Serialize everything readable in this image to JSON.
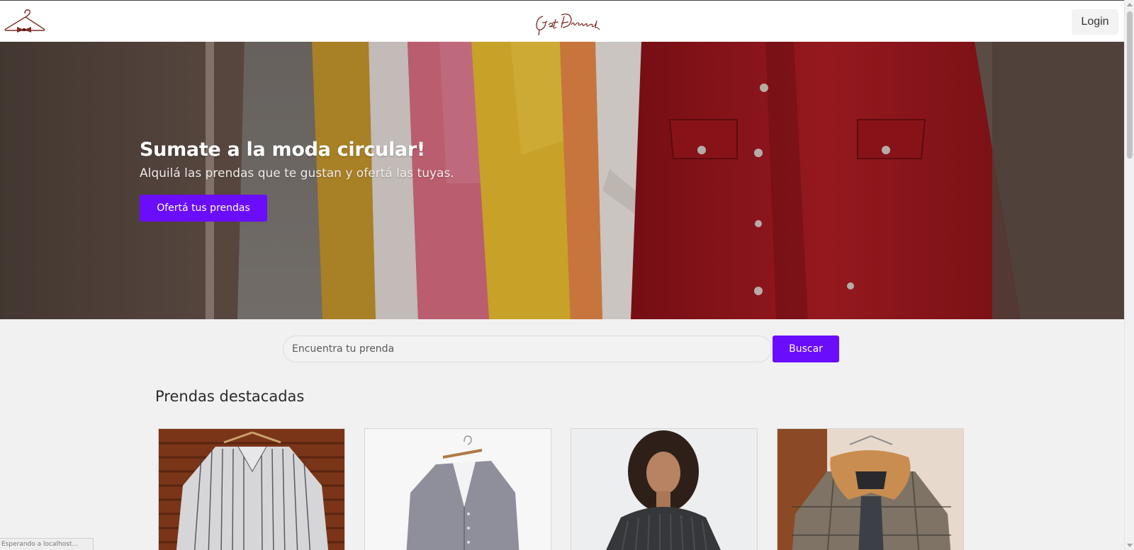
{
  "navbar": {
    "brand": "Get Dressed",
    "login_label": "Login"
  },
  "hero": {
    "title": "Sumate a la moda circular!",
    "subtitle": "Alquilá las prendas que te gustan y ofertá las tuyas.",
    "cta_label": "Ofertá tus prendas"
  },
  "search": {
    "placeholder": "Encuentra tu prenda",
    "button_label": "Buscar"
  },
  "featured": {
    "title": "Prendas destacadas",
    "items": [
      {
        "image": "striped-shirt-photo"
      },
      {
        "image": "grey-cardigan-photo"
      },
      {
        "image": "woman-knit-sweater-photo"
      },
      {
        "image": "plaid-coat-sherpa-collar-photo"
      }
    ]
  },
  "status_bar": {
    "text": "Esperando a localhost..."
  },
  "colors": {
    "accent": "#6a0dfb",
    "brand": "#7b2d26",
    "page_bg": "#f2f1f1"
  }
}
